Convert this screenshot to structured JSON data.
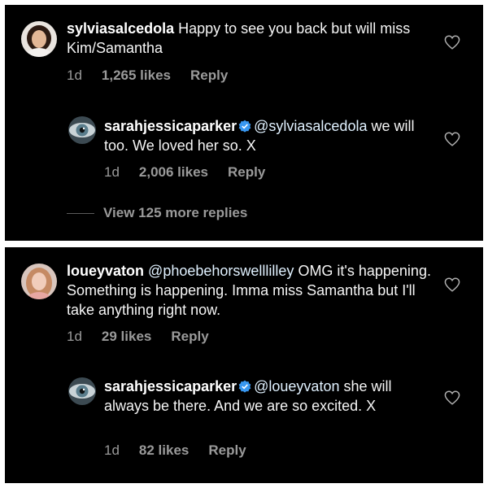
{
  "thread1": {
    "comment": {
      "username": "sylviasalcedola",
      "text": "Happy to see you back but will miss Kim/Samantha",
      "time": "1d",
      "likes": "1,265 likes",
      "reply": "Reply"
    },
    "reply": {
      "username": "sarahjessicaparker",
      "mention": "@sylviasalcedola",
      "text": "we will too. We loved her so. X",
      "time": "1d",
      "likes": "2,006 likes",
      "reply": "Reply"
    },
    "view_more": "View 125 more replies"
  },
  "thread2": {
    "comment": {
      "username": "loueyvaton",
      "mention": "@phoebehorswelllilley",
      "text": "OMG it's happening. Something is happening. Imma miss Samantha but I'll take anything right now.",
      "time": "1d",
      "likes": "29 likes",
      "reply": "Reply"
    },
    "reply": {
      "username": "sarahjessicaparker",
      "mention": "@loueyvaton",
      "text": "she will always be there. And we are so excited. X",
      "time": "1d",
      "likes": "82 likes",
      "reply": "Reply"
    }
  },
  "icons": {
    "heart": "heart-outline-icon",
    "verified": "verified-badge-icon"
  },
  "colors": {
    "background": "#000000",
    "separator": "#ffffff",
    "text": "#f5f5f5",
    "meta": "#9a9a9a",
    "verified": "#3897f0"
  }
}
